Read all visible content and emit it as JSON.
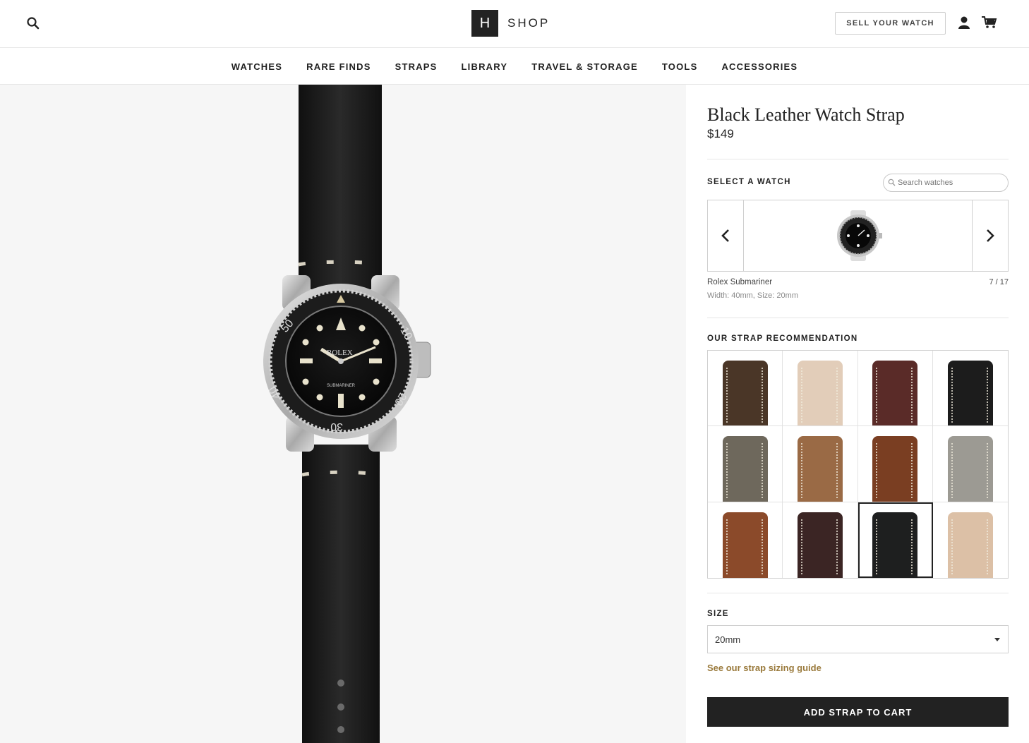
{
  "header": {
    "logo_mark": "H",
    "logo_text": "SHOP",
    "sell_label": "SELL YOUR WATCH"
  },
  "nav": {
    "items": [
      "WATCHES",
      "RARE FINDS",
      "STRAPS",
      "LIBRARY",
      "TRAVEL & STORAGE",
      "TOOLS",
      "ACCESSORIES"
    ]
  },
  "product": {
    "title": "Black Leather Watch Strap",
    "price": "$149"
  },
  "select_watch": {
    "label": "SELECT A WATCH",
    "search_placeholder": "Search watches",
    "watch_name": "Rolex Submariner",
    "watch_spec": "Width: 40mm, Size: 20mm",
    "position": "7 / 17"
  },
  "recommendation": {
    "label": "OUR STRAP RECOMMENDATION",
    "swatches": [
      {
        "color": "#4a3627"
      },
      {
        "color": "#e2cdb9"
      },
      {
        "color": "#5a2b28"
      },
      {
        "color": "#1c1c1c"
      },
      {
        "color": "#6e685c"
      },
      {
        "color": "#9a6a45"
      },
      {
        "color": "#7a3e22"
      },
      {
        "color": "#9c9a93"
      },
      {
        "color": "#8b4a2a"
      },
      {
        "color": "#3b2524"
      },
      {
        "color": "#1e1f1f"
      },
      {
        "color": "#dcc0a6"
      }
    ],
    "selected_index": 10
  },
  "size": {
    "label": "SIZE",
    "value": "20mm",
    "guide_link": "See our strap sizing guide"
  },
  "cart": {
    "add_label": "ADD STRAP TO CART"
  },
  "colors": {
    "accent_link": "#9a7a3c",
    "button_dark": "#222222"
  }
}
